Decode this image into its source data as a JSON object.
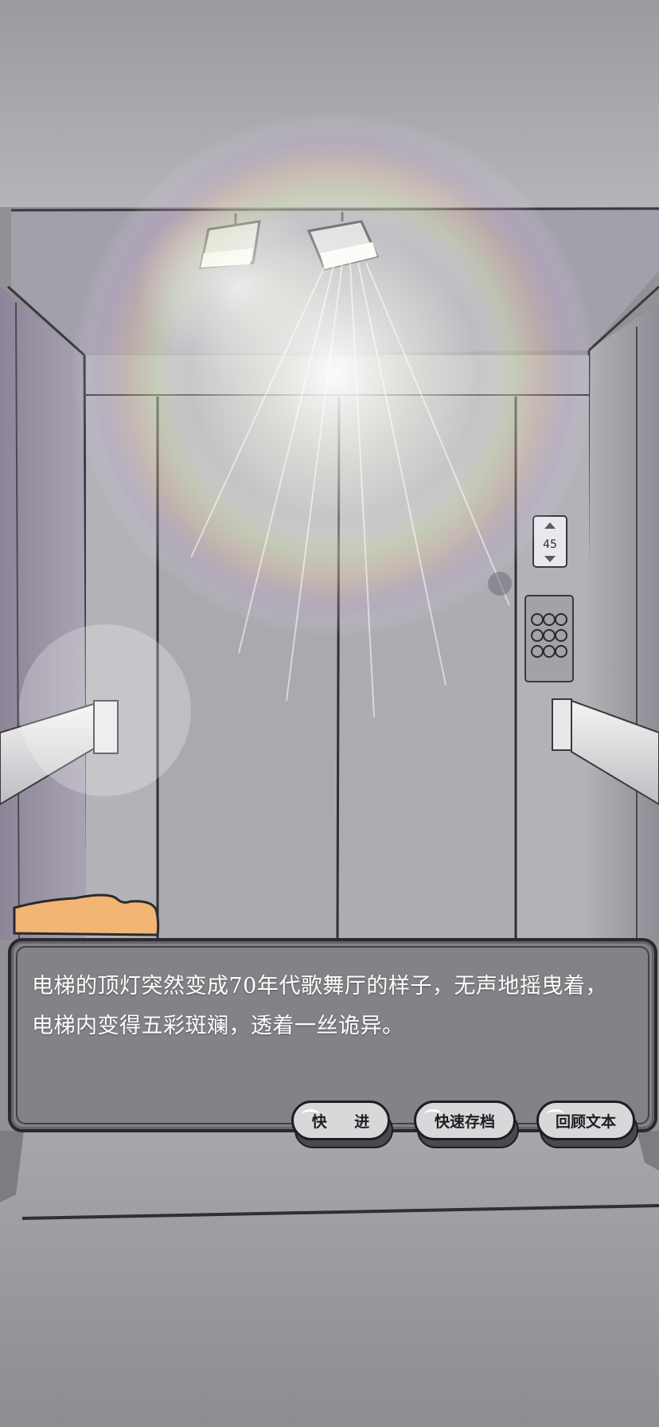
{
  "scene": {
    "floor_indicator": "45"
  },
  "dialog": {
    "lines": [
      "电梯的顶灯突然变成70年代歌舞厅的样子，无声地摇曳着，",
      "电梯内变得五彩斑斓，透着一丝诡异。"
    ]
  },
  "controls": {
    "fast_forward_label": "快 进",
    "quick_save_label": "快速存档",
    "review_text_label": "回顾文本"
  },
  "colors": {
    "name_tab": "#f2b574",
    "dialog_border": "#2a2a2e",
    "button_fill": "#d8d8da"
  }
}
